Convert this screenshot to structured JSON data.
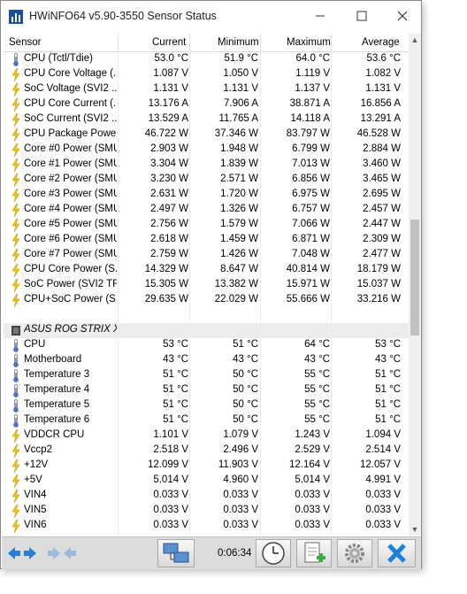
{
  "window": {
    "title": "HWiNFO64 v5.90-3550 Sensor Status"
  },
  "columns": [
    "Sensor",
    "Current",
    "Minimum",
    "Maximum",
    "Average"
  ],
  "rows": [
    {
      "icon": "thermometer",
      "name": "CPU (Tctl/Tdie)",
      "cur": "53.0 °C",
      "min": "51.9 °C",
      "max": "64.0 °C",
      "avg": "53.6 °C"
    },
    {
      "icon": "bolt",
      "name": "CPU Core Voltage (...",
      "cur": "1.087 V",
      "min": "1.050 V",
      "max": "1.119 V",
      "avg": "1.082 V"
    },
    {
      "icon": "bolt",
      "name": "SoC Voltage (SVI2 ...",
      "cur": "1.131 V",
      "min": "1.131 V",
      "max": "1.137 V",
      "avg": "1.131 V"
    },
    {
      "icon": "bolt",
      "name": "CPU Core Current (...",
      "cur": "13.176 A",
      "min": "7.906 A",
      "max": "38.871 A",
      "avg": "16.856 A"
    },
    {
      "icon": "bolt",
      "name": "SoC Current (SVI2 ...",
      "cur": "13.529 A",
      "min": "11.765 A",
      "max": "14.118 A",
      "avg": "13.291 A"
    },
    {
      "icon": "bolt",
      "name": "CPU Package Powe...",
      "cur": "46.722 W",
      "min": "37.346 W",
      "max": "83.797 W",
      "avg": "46.528 W"
    },
    {
      "icon": "bolt",
      "name": "Core #0 Power (SMU)",
      "cur": "2.903 W",
      "min": "1.948 W",
      "max": "6.799 W",
      "avg": "2.884 W"
    },
    {
      "icon": "bolt",
      "name": "Core #1 Power (SMU)",
      "cur": "3.304 W",
      "min": "1.839 W",
      "max": "7.013 W",
      "avg": "3.460 W"
    },
    {
      "icon": "bolt",
      "name": "Core #2 Power (SMU)",
      "cur": "3.230 W",
      "min": "2.571 W",
      "max": "6.856 W",
      "avg": "3.465 W"
    },
    {
      "icon": "bolt",
      "name": "Core #3 Power (SMU)",
      "cur": "2.631 W",
      "min": "1.720 W",
      "max": "6.975 W",
      "avg": "2.695 W"
    },
    {
      "icon": "bolt",
      "name": "Core #4 Power (SMU)",
      "cur": "2.497 W",
      "min": "1.326 W",
      "max": "6.757 W",
      "avg": "2.457 W"
    },
    {
      "icon": "bolt",
      "name": "Core #5 Power (SMU)",
      "cur": "2.756 W",
      "min": "1.579 W",
      "max": "7.066 W",
      "avg": "2.447 W"
    },
    {
      "icon": "bolt",
      "name": "Core #6 Power (SMU)",
      "cur": "2.618 W",
      "min": "1.459 W",
      "max": "6.871 W",
      "avg": "2.309 W"
    },
    {
      "icon": "bolt",
      "name": "Core #7 Power (SMU)",
      "cur": "2.759 W",
      "min": "1.426 W",
      "max": "7.048 W",
      "avg": "2.477 W"
    },
    {
      "icon": "bolt",
      "name": "CPU Core Power (S...",
      "cur": "14.329 W",
      "min": "8.647 W",
      "max": "40.814 W",
      "avg": "18.179 W"
    },
    {
      "icon": "bolt",
      "name": "SoC Power (SVI2 TFN)",
      "cur": "15.305 W",
      "min": "13.382 W",
      "max": "15.971 W",
      "avg": "15.037 W"
    },
    {
      "icon": "bolt",
      "name": "CPU+SoC Power (S...",
      "cur": "29.635 W",
      "min": "22.029 W",
      "max": "55.666 W",
      "avg": "33.216 W"
    },
    {
      "icon": "blank",
      "name": "",
      "cur": "",
      "min": "",
      "max": "",
      "avg": ""
    },
    {
      "icon": "chip",
      "name": "ASUS ROG STRIX X...",
      "cur": "",
      "min": "",
      "max": "",
      "avg": "",
      "group": true
    },
    {
      "icon": "thermometer",
      "name": "CPU",
      "cur": "53 °C",
      "min": "51 °C",
      "max": "64 °C",
      "avg": "53 °C"
    },
    {
      "icon": "thermometer",
      "name": "Motherboard",
      "cur": "43 °C",
      "min": "43 °C",
      "max": "43 °C",
      "avg": "43 °C"
    },
    {
      "icon": "thermometer",
      "name": "Temperature 3",
      "cur": "51 °C",
      "min": "50 °C",
      "max": "55 °C",
      "avg": "51 °C"
    },
    {
      "icon": "thermometer",
      "name": "Temperature 4",
      "cur": "51 °C",
      "min": "50 °C",
      "max": "55 °C",
      "avg": "51 °C"
    },
    {
      "icon": "thermometer",
      "name": "Temperature 5",
      "cur": "51 °C",
      "min": "50 °C",
      "max": "55 °C",
      "avg": "51 °C"
    },
    {
      "icon": "thermometer",
      "name": "Temperature 6",
      "cur": "51 °C",
      "min": "50 °C",
      "max": "55 °C",
      "avg": "51 °C"
    },
    {
      "icon": "bolt",
      "name": "VDDCR CPU",
      "cur": "1.101 V",
      "min": "1.079 V",
      "max": "1.243 V",
      "avg": "1.094 V"
    },
    {
      "icon": "bolt",
      "name": "Vccp2",
      "cur": "2.518 V",
      "min": "2.496 V",
      "max": "2.529 V",
      "avg": "2.514 V"
    },
    {
      "icon": "bolt",
      "name": "+12V",
      "cur": "12.099 V",
      "min": "11.903 V",
      "max": "12.164 V",
      "avg": "12.057 V"
    },
    {
      "icon": "bolt",
      "name": "+5V",
      "cur": "5.014 V",
      "min": "4.960 V",
      "max": "5.014 V",
      "avg": "4.991 V"
    },
    {
      "icon": "bolt",
      "name": "VIN4",
      "cur": "0.033 V",
      "min": "0.033 V",
      "max": "0.033 V",
      "avg": "0.033 V"
    },
    {
      "icon": "bolt",
      "name": "VIN5",
      "cur": "0.033 V",
      "min": "0.033 V",
      "max": "0.033 V",
      "avg": "0.033 V"
    },
    {
      "icon": "bolt",
      "name": "VIN6",
      "cur": "0.033 V",
      "min": "0.033 V",
      "max": "0.033 V",
      "avg": "0.033 V"
    }
  ],
  "footer": {
    "timer": "0:06:34"
  },
  "colors": {
    "bolt": "#f5c400",
    "thermometer": "#4a74c9",
    "accent": "#2a7fd4",
    "close": "#1a82d8"
  }
}
